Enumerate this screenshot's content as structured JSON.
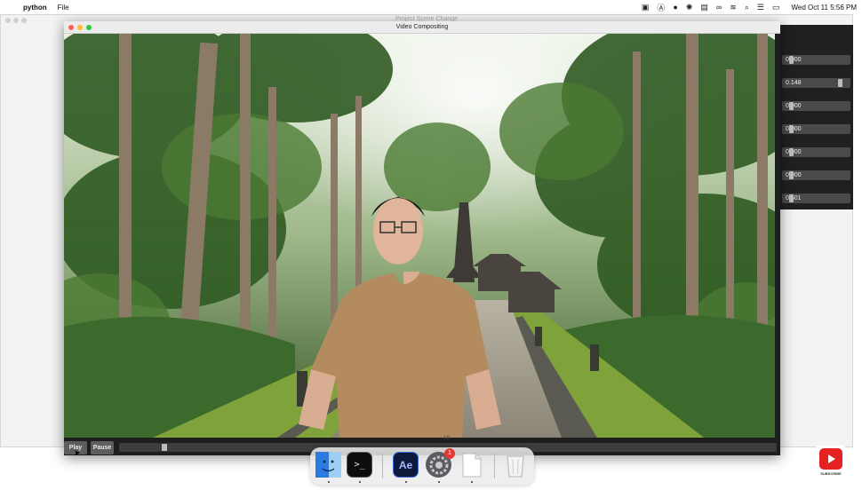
{
  "menubar": {
    "app_name": "python",
    "menus": [
      "File"
    ],
    "datetime": "Wed Oct 11  5:56 PM",
    "status_icons": [
      "screen-record-icon",
      "a-circle-icon",
      "d-circle-icon",
      "loading-icon",
      "us-flag-icon",
      "infinity-icon",
      "wifi-icon",
      "search-icon",
      "control-center-icon",
      "display-icon"
    ]
  },
  "back_window": {
    "title": "Project Scene Change"
  },
  "front_window": {
    "title": "Video Compositing"
  },
  "sliders": [
    {
      "value": "0.000",
      "level": 0.0
    },
    {
      "value": "0.148",
      "level": 0.88
    },
    {
      "value": "0.000",
      "level": 0.0
    },
    {
      "value": "0.000",
      "level": 0.0
    },
    {
      "value": "0.000",
      "level": 0.0
    },
    {
      "value": "0.000",
      "level": 0.0
    },
    {
      "value": "0.601",
      "level": 0.0
    }
  ],
  "controls": {
    "play_label": "Play",
    "pause_label": "Pause",
    "frame": "19"
  },
  "dock": {
    "items": [
      {
        "name": "finder-icon",
        "running": true
      },
      {
        "name": "terminal-icon",
        "running": true
      },
      {
        "name": "after-effects-icon",
        "label": "Ae",
        "running": true
      },
      {
        "name": "system-settings-icon",
        "badge": "1",
        "running": true
      },
      {
        "name": "document-icon",
        "running": true
      },
      {
        "name": "trash-icon",
        "running": false
      }
    ]
  },
  "subscribe": {
    "label": "SUBSCRIBE"
  },
  "colors": {
    "window_bg": "#1e1e1e",
    "slider_track": "#4a4a4a",
    "accent_red": "#e53935",
    "youtube_red": "#e52222"
  }
}
